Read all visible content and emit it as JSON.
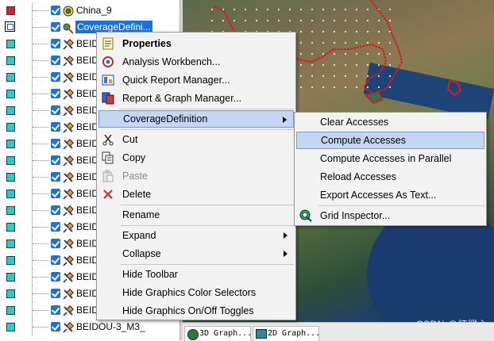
{
  "tree": {
    "items": [
      {
        "label": "China_9",
        "box_color": "#e02020",
        "type": "area"
      },
      {
        "label": "CoverageDefini...",
        "box_color": "#ffffff",
        "type": "coverage",
        "selected": true
      },
      {
        "label": "BEIDOU",
        "box_color": "#20d0d0",
        "type": "satellite"
      },
      {
        "label": "BEIDOU",
        "box_color": "#20d0d0",
        "type": "satellite"
      },
      {
        "label": "BEIDOU",
        "box_color": "#20d0d0",
        "type": "satellite"
      },
      {
        "label": "BEIDOU",
        "box_color": "#20d0d0",
        "type": "satellite"
      },
      {
        "label": "BEIDOU",
        "box_color": "#20d0d0",
        "type": "satellite"
      },
      {
        "label": "BEIDOU",
        "box_color": "#20d0d0",
        "type": "satellite"
      },
      {
        "label": "BEIDOU",
        "box_color": "#20d0d0",
        "type": "satellite"
      },
      {
        "label": "BEIDOU",
        "box_color": "#20d0d0",
        "type": "satellite"
      },
      {
        "label": "BEIDOU",
        "box_color": "#20d0d0",
        "type": "satellite"
      },
      {
        "label": "BEIDOU",
        "box_color": "#20d0d0",
        "type": "satellite"
      },
      {
        "label": "BEIDOU",
        "box_color": "#20d0d0",
        "type": "satellite"
      },
      {
        "label": "BEIDOU",
        "box_color": "#20d0d0",
        "type": "satellite"
      },
      {
        "label": "BEIDOU",
        "box_color": "#20d0d0",
        "type": "satellite"
      },
      {
        "label": "BEIDOU",
        "box_color": "#20d0d0",
        "type": "satellite"
      },
      {
        "label": "BEIDOU",
        "box_color": "#20d0d0",
        "type": "satellite"
      },
      {
        "label": "BEIDOU",
        "box_color": "#20d0d0",
        "type": "satellite"
      },
      {
        "label": "BEIDOU",
        "box_color": "#20d0d0",
        "type": "satellite"
      },
      {
        "label": "BEIDOU-3_M3_",
        "box_color": "#20d0d0",
        "type": "satellite"
      }
    ]
  },
  "context_menu": {
    "items": [
      {
        "label": "Properties",
        "bold": true,
        "icon": "properties-icon"
      },
      {
        "label": "Analysis Workbench...",
        "icon": "analysis-workbench-icon"
      },
      {
        "label": "Quick Report Manager...",
        "icon": "quick-report-icon"
      },
      {
        "label": "Report & Graph Manager...",
        "icon": "report-graph-icon"
      },
      {
        "sep": true
      },
      {
        "label": "CoverageDefinition",
        "submenu": true,
        "highlighted": true
      },
      {
        "sep": true
      },
      {
        "label": "Cut",
        "icon": "cut-icon"
      },
      {
        "label": "Copy",
        "icon": "copy-icon"
      },
      {
        "label": "Paste",
        "icon": "paste-icon",
        "disabled": true
      },
      {
        "label": "Delete",
        "icon": "delete-icon"
      },
      {
        "sep": true
      },
      {
        "label": "Rename"
      },
      {
        "sep": true
      },
      {
        "label": "Expand",
        "submenu": true
      },
      {
        "label": "Collapse",
        "submenu": true
      },
      {
        "sep": true
      },
      {
        "label": "Hide Toolbar"
      },
      {
        "label": "Hide Graphics Color Selectors"
      },
      {
        "label": "Hide Graphics On/Off Toggles"
      }
    ]
  },
  "submenu": {
    "items": [
      {
        "label": "Clear Accesses"
      },
      {
        "label": "Compute Accesses",
        "highlighted": true
      },
      {
        "label": "Compute Accesses in Parallel"
      },
      {
        "label": "Reload Accesses"
      },
      {
        "label": "Export Accesses As Text..."
      },
      {
        "sep": true
      },
      {
        "label": "Grid Inspector...",
        "icon": "grid-inspector-icon"
      }
    ]
  },
  "tabs": [
    {
      "label": "3D Graph..."
    },
    {
      "label": "2D Graph..."
    }
  ],
  "watermark": "CSDN @红鲨心",
  "colors": {
    "selection": "#1672e3",
    "menu_highlight": "#c5d6f3",
    "menu_highlight_border": "#7a9bd5",
    "checkbox": "#1e73d6",
    "border_red": "#e01818"
  }
}
